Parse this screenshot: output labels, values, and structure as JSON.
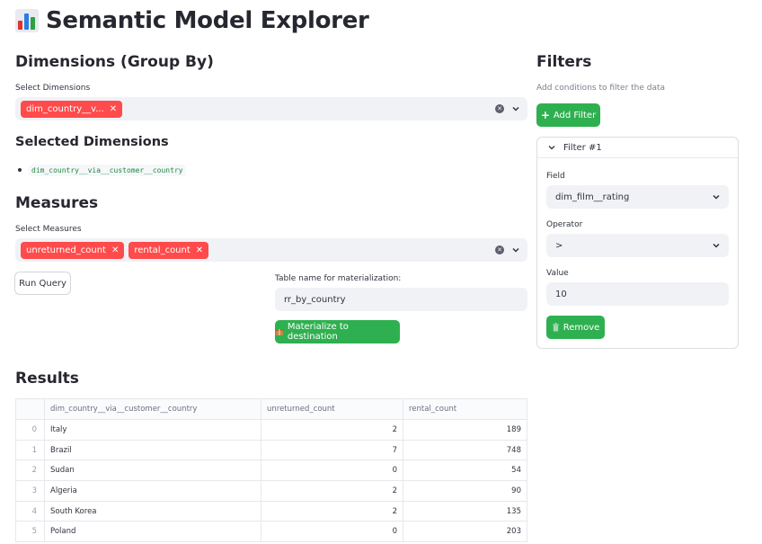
{
  "header": {
    "title": "Semantic Model Explorer",
    "icon": "bar-chart-icon"
  },
  "dimensions": {
    "heading": "Dimensions (Group By)",
    "select_label": "Select Dimensions",
    "tags": [
      {
        "label": "dim_country__v..."
      }
    ],
    "selected_heading": "Selected Dimensions",
    "selected_items": [
      "dim_country__via__customer__country"
    ]
  },
  "measures": {
    "heading": "Measures",
    "select_label": "Select Measures",
    "tags": [
      {
        "label": "unreturned_count"
      },
      {
        "label": "rental_count"
      }
    ]
  },
  "actions": {
    "run_query": "Run Query",
    "table_name_label": "Table name for materialization:",
    "table_name_value": "rr_by_country",
    "materialize": "Materialize to destination",
    "materialize_icon": "package-icon"
  },
  "filters": {
    "heading": "Filters",
    "caption": "Add conditions to filter the data",
    "add_button": "Add Filter",
    "add_icon": "plus-icon",
    "filter": {
      "title": "Filter #1",
      "field_label": "Field",
      "field_value": "dim_film__rating",
      "operator_label": "Operator",
      "operator_value": ">",
      "value_label": "Value",
      "value_value": "10",
      "remove_button": "Remove",
      "remove_icon": "trash-icon"
    }
  },
  "results": {
    "heading": "Results",
    "columns": [
      "",
      "dim_country__via__customer__country",
      "unreturned_count",
      "rental_count"
    ],
    "rows": [
      {
        "idx": "0",
        "country": "Italy",
        "unreturned": "2",
        "rental": "189"
      },
      {
        "idx": "1",
        "country": "Brazil",
        "unreturned": "7",
        "rental": "748"
      },
      {
        "idx": "2",
        "country": "Sudan",
        "unreturned": "0",
        "rental": "54"
      },
      {
        "idx": "3",
        "country": "Algeria",
        "unreturned": "2",
        "rental": "90"
      },
      {
        "idx": "4",
        "country": "South Korea",
        "unreturned": "2",
        "rental": "135"
      },
      {
        "idx": "5",
        "country": "Poland",
        "unreturned": "0",
        "rental": "203"
      }
    ]
  },
  "colors": {
    "tag": "#ff4b4b",
    "button": "#2fb050",
    "input_bg": "#f0f2f6",
    "code": "#1f8a3b"
  }
}
